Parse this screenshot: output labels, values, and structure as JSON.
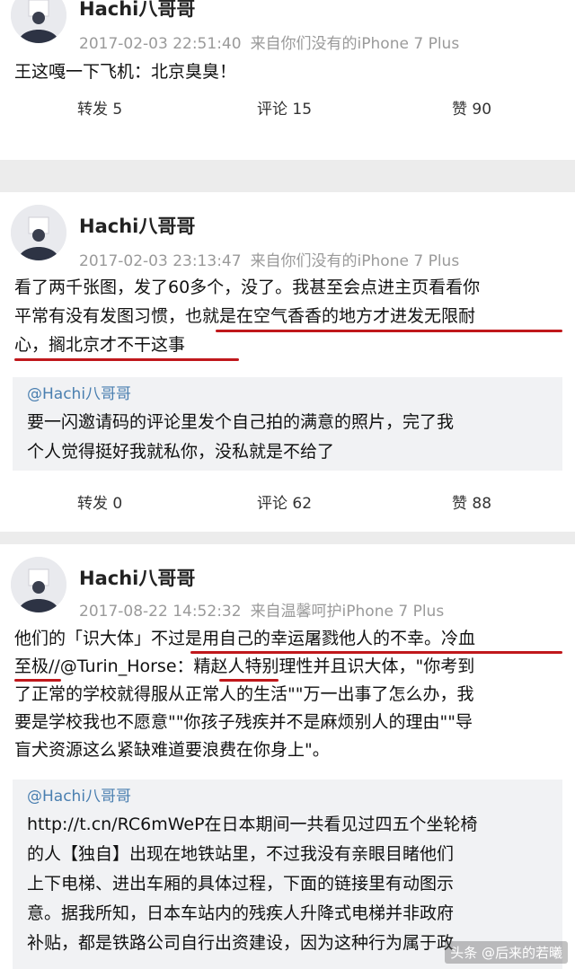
{
  "posts": [
    {
      "user": "Hachi八哥哥",
      "timestamp": "2017-02-03 22:51:40",
      "source": "来自你们没有的iPhone 7 Plus",
      "text_lines": [
        "王这嘎一下飞机：北京臭臭！"
      ],
      "actions": {
        "repost": "转发 5",
        "comment": "评论 15",
        "like": "赞 90"
      }
    },
    {
      "user": "Hachi八哥哥",
      "timestamp": "2017-02-03 23:13:47",
      "source": "来自你们没有的iPhone 7 Plus",
      "text_lines": [
        "看了两千张图，发了60多个，没了。我甚至会点进主页看看你",
        "平常有没有发图习惯，也就是在空气香香的地方才进发无限耐",
        "心，搁北京才不干这事"
      ],
      "repost": {
        "user": "@Hachi八哥哥",
        "text_lines": [
          "要一闪邀请码的评论里发个自己拍的满意的照片，完了我",
          "个人觉得挺好我就私你，没私就是不给了"
        ]
      },
      "actions": {
        "repost": "转发 0",
        "comment": "评论 62",
        "like": "赞 88"
      }
    },
    {
      "user": "Hachi八哥哥",
      "timestamp": "2017-08-22 14:52:32",
      "source": "来自温馨呵护iPhone 7 Plus",
      "text_lines": [
        "他们的「识大体」不过是用自己的幸运屠戮他人的不幸。冷血",
        "至极//@Turin_Horse：精赵人特别理性并且识大体，\"你考到",
        "了正常的学校就得服从正常人的生活\"\"万一出事了怎么办，我",
        "要是学校我也不愿意\"\"你孩子残疾并不是麻烦别人的理由\"\"导",
        "盲犬资源这么紧缺难道要浪费在你身上\"。"
      ],
      "repost": {
        "user": "@Hachi八哥哥",
        "text_lines": [
          "http://t.cn/RC6mWeP在日本期间一共看见过四五个坐轮椅",
          "的人【独自】出现在地铁站里，不过我没有亲眼目睹他们",
          "上下电梯、进出车厢的具体过程，下面的链接里有动图示",
          "意。据我所知，日本车站内的残疾人升降式电梯并非政府",
          "补贴，都是铁路公司自行出资建设，因为这种行为属于政"
        ]
      }
    }
  ],
  "watermark": "头条 @后来的若曦",
  "colors": {
    "underline": "#c0181c",
    "meta": "#9a9a9a",
    "repost_bg": "#f1f2f4",
    "mention": "#4a7fb0"
  }
}
